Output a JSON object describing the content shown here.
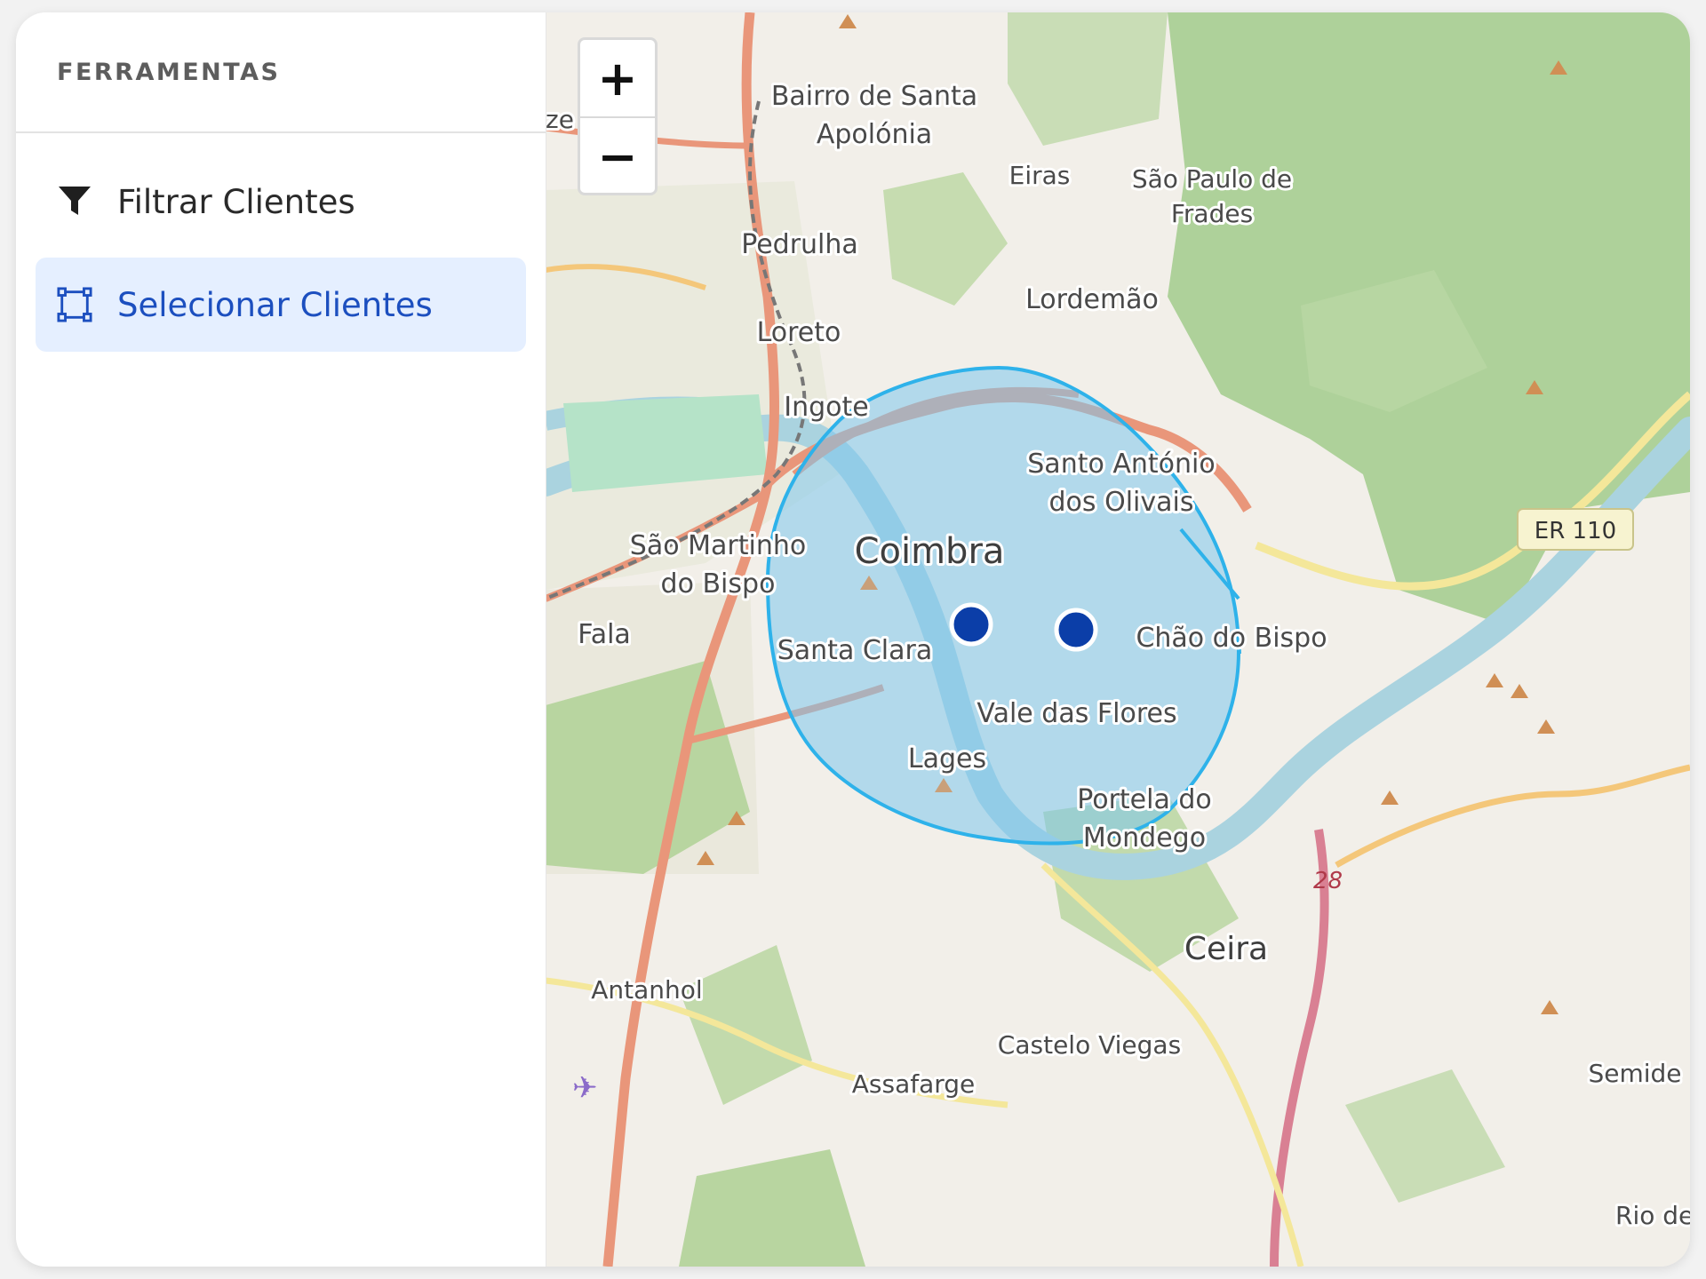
{
  "sidebar": {
    "title": "FERRAMENTAS",
    "items": [
      {
        "label": "Filtrar Clientes",
        "icon": "filter-icon",
        "active": false
      },
      {
        "label": "Selecionar Clientes",
        "icon": "selection-square-icon",
        "active": true
      }
    ]
  },
  "map": {
    "zoom_in_label": "+",
    "zoom_out_label": "−",
    "places": {
      "ze": "ze",
      "bairro_santa_apolonia_1": "Bairro de Santa",
      "bairro_santa_apolonia_2": "Apolónia",
      "eiras": "Eiras",
      "sao_paulo_1": "São Paulo de",
      "sao_paulo_2": "Frades",
      "pedrulha": "Pedrulha",
      "lordemao": "Lordemão",
      "loreto": "Loreto",
      "ingote": "Ingote",
      "santo_antonio_1": "Santo António",
      "santo_antonio_2": "dos Olivais",
      "sao_martinho_1": "São Martinho",
      "sao_martinho_2": "do Bispo",
      "coimbra": "Coimbra",
      "fala": "Fala",
      "santa_clara": "Santa Clara",
      "chao_do_bispo": "Chão do Bispo",
      "vale_das_flores": "Vale das Flores",
      "lages": "Lages",
      "portela_1": "Portela do",
      "portela_2": "Mondego",
      "ceira": "Ceira",
      "antanhol": "Antanhol",
      "castelo_viegas": "Castelo Viegas",
      "assafarge": "Assafarge",
      "semide": "Semide",
      "rio_de": "Rio de V"
    },
    "road_labels": {
      "er110": "ER 110",
      "n28": "28"
    },
    "colors": {
      "land": "#f2efe9",
      "forest": "#aed19a",
      "river": "#aad3df",
      "major_road": "#e9967a",
      "yellow_road": "#f4e79a",
      "selection_fill": "#7ec6ec",
      "selection_stroke": "#2eb2ea",
      "marker": "#0b3ea8",
      "active_item_bg": "#e5efff",
      "active_item_text": "#1c4fbf"
    },
    "markers": [
      {
        "name": "client-1"
      },
      {
        "name": "client-2"
      }
    ]
  }
}
